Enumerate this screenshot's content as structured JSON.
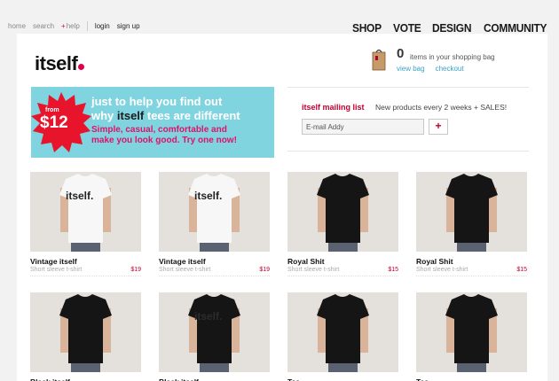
{
  "top_links": {
    "home": "home",
    "search": "search",
    "help_plus": "+",
    "help": "help",
    "login": "login",
    "signup": "sign up"
  },
  "main_nav": [
    "SHOP",
    "VOTE",
    "DESIGN",
    "COMMUNITY"
  ],
  "logo": {
    "text": "itself"
  },
  "cart": {
    "count": "0",
    "text": "items in your shopping bag",
    "view_bag": "view bag",
    "checkout": "checkout"
  },
  "promo": {
    "from": "from",
    "price": "$12",
    "headline_1": "just to help you find out",
    "headline_2a": "why ",
    "headline_2b": "itself",
    "headline_2c": " tees are different",
    "sub_1": "Simple, casual, comfortable and",
    "sub_2": "make you look good. Try one now!"
  },
  "mailing": {
    "title": "itself mailing list",
    "desc": "New products every 2 weeks + SALES!",
    "input_value": "E-mail Addy",
    "button": "+"
  },
  "products": [
    {
      "name": "Vintage itself",
      "type": "Short sleeve t-shirt",
      "price": "$19",
      "color": "white",
      "print": "itself."
    },
    {
      "name": "Vintage itself",
      "type": "Short sleeve t-shirt",
      "price": "$19",
      "color": "white",
      "print": "itself."
    },
    {
      "name": "Royal Shit",
      "type": "Short sleeve t-shirt",
      "price": "$15",
      "color": "black",
      "print": ""
    },
    {
      "name": "Royal Shit",
      "type": "Short sleeve t-shirt",
      "price": "$15",
      "color": "black",
      "print": ""
    },
    {
      "name": "Black itself",
      "type": "",
      "price": "",
      "color": "black",
      "print": ""
    },
    {
      "name": "Black itself",
      "type": "",
      "price": "",
      "color": "black",
      "print": "itself."
    },
    {
      "name": "Tee",
      "type": "",
      "price": "",
      "color": "black",
      "print": ""
    },
    {
      "name": "Tee",
      "type": "",
      "price": "",
      "color": "black",
      "print": ""
    }
  ],
  "colors": {
    "accent": "#e0004d",
    "price": "#c0002f",
    "promo_bg": "#7fd4e0",
    "link": "#3aa0c8"
  }
}
